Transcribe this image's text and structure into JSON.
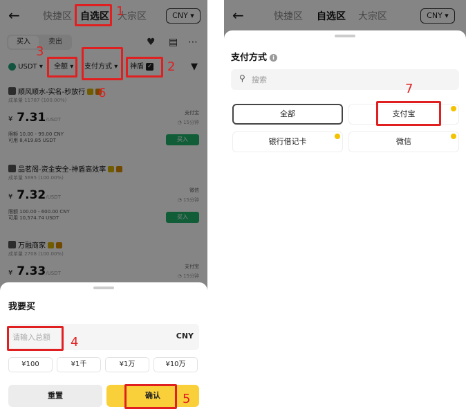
{
  "header": {
    "tabs": [
      "快捷区",
      "自选区",
      "大宗区"
    ],
    "currency": "CNY"
  },
  "trade_tabs": [
    "买入",
    "卖出"
  ],
  "filters": {
    "coin": "USDT",
    "amount": "全额",
    "payment": "支付方式",
    "shield": "神盾"
  },
  "merchants": [
    {
      "name": "顺风顺水-实名-秒放行",
      "meta": "成单量 11787 (100.00%)",
      "price": "7.31",
      "currency_symbol": "¥",
      "unit": "/USDT",
      "limit": "限额 10.00 - 99.00 CNY",
      "available": "可用 8,419.85 USDT",
      "pay_method": "支付宝",
      "time": "15分钟",
      "buy_label": "买入"
    },
    {
      "name": "品茗阁-资金安全-神盾高效率",
      "meta": "成单量 5695 (100.00%)",
      "price": "7.32",
      "currency_symbol": "¥",
      "unit": "/USDT",
      "limit": "限额 100.00 - 600.00 CNY",
      "available": "可用 10,574.74 USDT",
      "pay_method": "微信",
      "time": "15分钟",
      "buy_label": "买入"
    },
    {
      "name": "万融商家",
      "meta": "成单量 2708 (100.00%)",
      "price": "7.33",
      "currency_symbol": "¥",
      "unit": "/USDT",
      "pay_method": "支付宝",
      "time": "15分钟"
    }
  ],
  "buy_sheet": {
    "title": "我要买",
    "placeholder": "请输入总额",
    "suffix": "CNY",
    "presets": [
      "¥100",
      "¥1千",
      "¥1万",
      "¥10万"
    ],
    "reset": "重置",
    "confirm": "确认"
  },
  "payment_sheet": {
    "title": "支付方式",
    "search_placeholder": "搜索",
    "options": [
      "全部",
      "支付宝",
      "银行借记卡",
      "微信"
    ]
  },
  "annotations": [
    "1",
    "2",
    "3",
    "4",
    "5",
    "6",
    "7"
  ],
  "colors": {
    "accent_yellow": "#f9d03a",
    "buy_green": "#20b26b",
    "annotation_red": "#e02020"
  }
}
